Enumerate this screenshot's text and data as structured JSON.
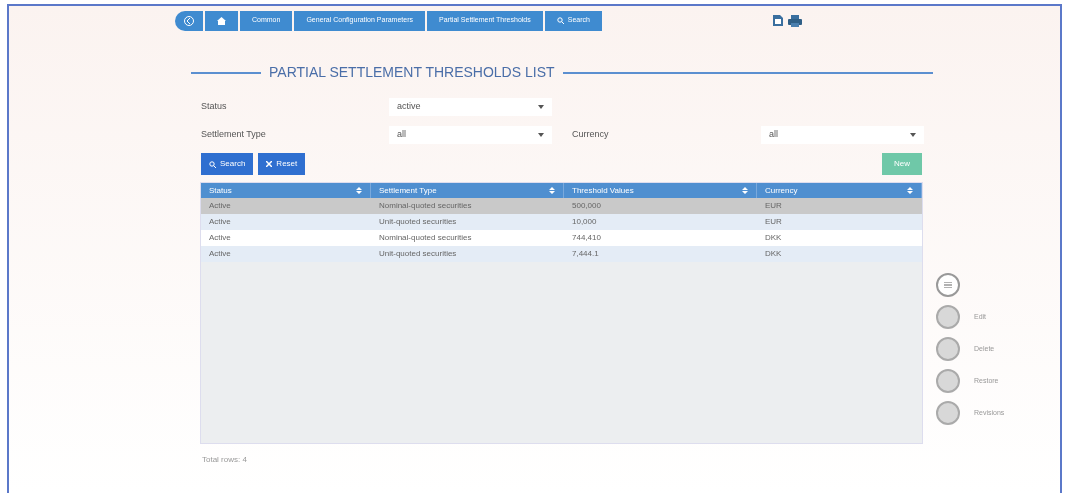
{
  "breadcrumb": [
    {
      "kind": "back"
    },
    {
      "kind": "home"
    },
    {
      "kind": "text",
      "label": "Common"
    },
    {
      "kind": "text",
      "label": "General Configuration Parameters"
    },
    {
      "kind": "text",
      "label": "Partial Settlement Thresholds"
    },
    {
      "kind": "search",
      "label": "Search"
    }
  ],
  "title": "PARTIAL SETTLEMENT THRESHOLDS LIST",
  "filters": {
    "status": {
      "label": "Status",
      "value": "active"
    },
    "settlement_type": {
      "label": "Settlement Type",
      "value": "all"
    },
    "currency": {
      "label": "Currency",
      "value": "all"
    }
  },
  "buttons": {
    "search": "Search",
    "reset": "Reset",
    "new": "New"
  },
  "table": {
    "columns": [
      "Status",
      "Settlement Type",
      "Threshold Values",
      "Currency"
    ],
    "rows": [
      {
        "cells": [
          "Active",
          "Nominal-quoted securities",
          "500,000",
          "EUR"
        ],
        "selected": true
      },
      {
        "cells": [
          "Active",
          "Unit-quoted securities",
          "10,000",
          "EUR"
        ],
        "selected": false
      },
      {
        "cells": [
          "Active",
          "Nominal-quoted securities",
          "744,410",
          "DKK"
        ],
        "selected": false
      },
      {
        "cells": [
          "Active",
          "Unit-quoted securities",
          "7,444.1",
          "DKK"
        ],
        "selected": false
      }
    ]
  },
  "actions": [
    "Edit",
    "Delete",
    "Restore",
    "Revisions"
  ],
  "footer": "Total rows: 4"
}
